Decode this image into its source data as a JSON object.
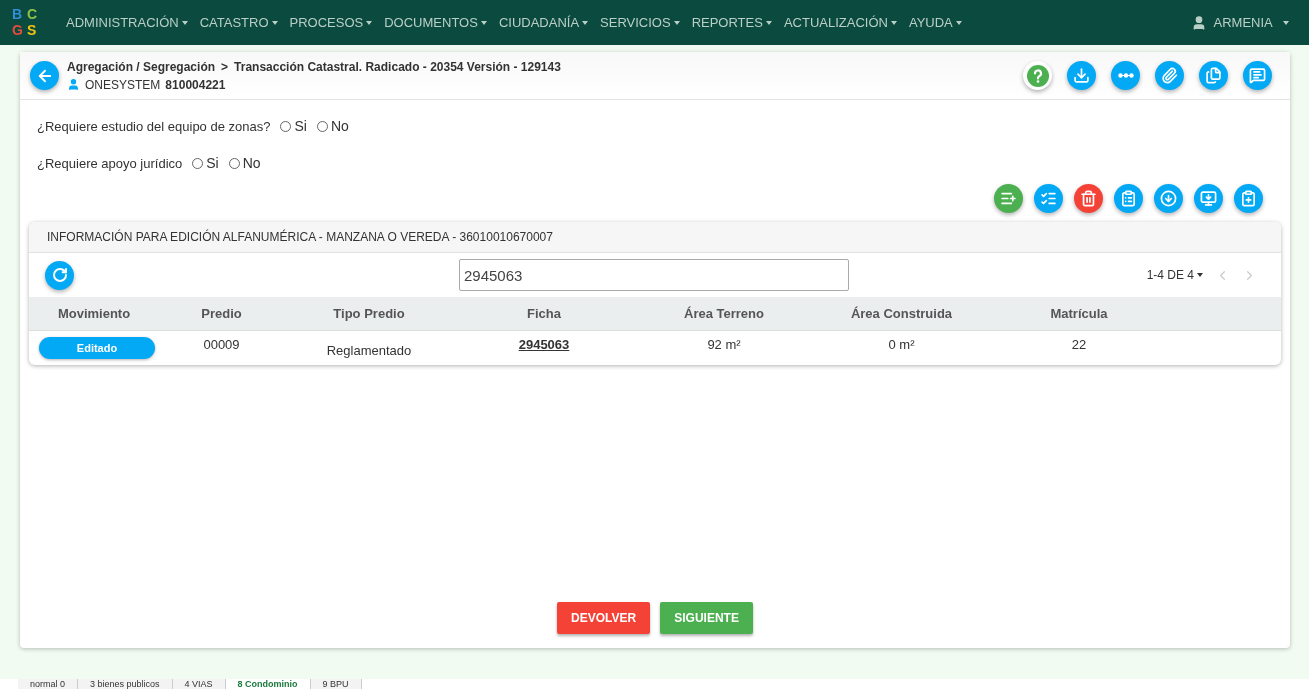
{
  "navbar": {
    "logo": [
      "B",
      "C",
      "G",
      "S"
    ],
    "menus": [
      {
        "label": "ADMINISTRACIÓN"
      },
      {
        "label": "CATASTRO"
      },
      {
        "label": "PROCESOS"
      },
      {
        "label": "DOCUMENTOS"
      },
      {
        "label": "CIUDADANÍA"
      },
      {
        "label": "SERVICIOS"
      },
      {
        "label": "REPORTES"
      },
      {
        "label": "ACTUALIZACIÓN"
      },
      {
        "label": "AYUDA"
      }
    ],
    "user": "ARMENIA"
  },
  "header": {
    "breadcrumb": [
      "Agregación / Segregación",
      "Transacción Catastral. Radicado - 20354 Versión - 129143"
    ],
    "breadcrumb_separator": ">",
    "owner_name": "ONESYSTEM",
    "owner_id": "810004221",
    "actions": [
      {
        "kind": "help",
        "color": "#4caf50"
      },
      {
        "kind": "download",
        "color": "#03a9f4"
      },
      {
        "kind": "more",
        "color": "#03a9f4"
      },
      {
        "kind": "attach",
        "color": "#03a9f4"
      },
      {
        "kind": "copy",
        "color": "#03a9f4"
      },
      {
        "kind": "comment",
        "color": "#03a9f4"
      }
    ]
  },
  "questions": [
    {
      "label": "¿Requiere estudio del equipo de zonas?",
      "options": [
        {
          "label": "Si",
          "selected": false
        },
        {
          "label": "No",
          "selected": false
        }
      ]
    },
    {
      "label": "¿Requiere apoyo jurídico",
      "options": [
        {
          "label": "Si",
          "selected": false
        },
        {
          "label": "No",
          "selected": false
        }
      ]
    }
  ],
  "tools": [
    {
      "kind": "list-add",
      "color": "#4caf50"
    },
    {
      "kind": "list-check",
      "color": "#03a9f4"
    },
    {
      "kind": "delete",
      "color": "#f44336"
    },
    {
      "kind": "clipboard",
      "color": "#03a9f4"
    },
    {
      "kind": "circle-down",
      "color": "#03a9f4"
    },
    {
      "kind": "monitor-down",
      "color": "#03a9f4"
    },
    {
      "kind": "clipboard-add",
      "color": "#03a9f4"
    }
  ],
  "table": {
    "title": "INFORMACIÓN PARA EDICIÓN ALFANUMÉRICA - MANZANA O VEREDA - 36010010670007",
    "search_value": "2945063",
    "pagination": "1-4 DE 4",
    "columns": [
      "Movimiento",
      "Predio",
      "Tipo Predio",
      "Ficha",
      "Área Terreno",
      "Área Construida",
      "Matrícula"
    ],
    "rows": [
      {
        "movimiento": "Editado",
        "predio": "00009",
        "tipo_predio": "Reglamentado",
        "ficha": "2945063",
        "area_terreno": "92 m²",
        "area_construida": "0 m²",
        "matricula": "22"
      }
    ]
  },
  "buttons": [
    {
      "label": "DEVOLVER",
      "color": "#f44336"
    },
    {
      "label": "SIGUIENTE",
      "color": "#4caf50"
    }
  ],
  "sheet_tabs": [
    {
      "label": "normal 0",
      "selected": false
    },
    {
      "label": "3 bienes publicos",
      "selected": false
    },
    {
      "label": "4 VIAS",
      "selected": false
    },
    {
      "label": "8 Condominio",
      "selected": true
    },
    {
      "label": "9 BPU",
      "selected": false
    }
  ]
}
